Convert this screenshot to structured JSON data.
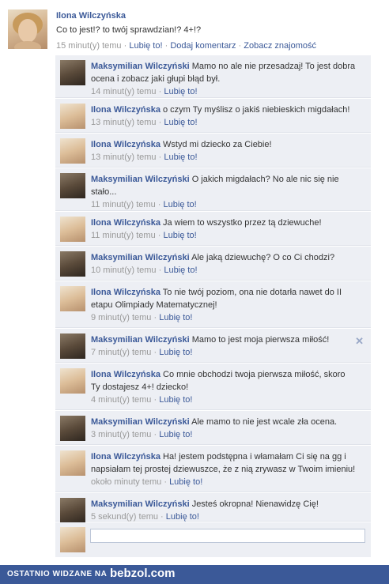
{
  "post": {
    "author": "Ilona Wilczyńska",
    "text": "Co to jest!? to twój sprawdzian!? 4+!?",
    "time": "15 minut(y) temu",
    "like": "Lubię to!",
    "add_comment": "Dodaj komentarz",
    "see_friendship": "Zobacz znajomość",
    "separator": "·"
  },
  "comments": [
    {
      "author": "Maksymilian Wilczyński",
      "avatar": "son-avatar",
      "text": "Mamo no ale nie przesadzaj! To jest dobra ocena i zobacz jaki głupi błąd był.",
      "time": "14 minut(y) temu",
      "like": "Lubię to!"
    },
    {
      "author": "Ilona Wilczyńska",
      "avatar": "mother-avatar",
      "text": "o czym Ty myślisz o jakiś niebieskich migdałach!",
      "time": "13 minut(y) temu",
      "like": "Lubię to!"
    },
    {
      "author": "Ilona Wilczyńska",
      "avatar": "mother-avatar",
      "text": "Wstyd mi dziecko za Ciebie!",
      "time": "13 minut(y) temu",
      "like": "Lubię to!"
    },
    {
      "author": "Maksymilian Wilczyński",
      "avatar": "son-avatar",
      "text": "O jakich migdałach? No ale nic się nie stało...",
      "time": "11 minut(y) temu",
      "like": "Lubię to!"
    },
    {
      "author": "Ilona Wilczyńska",
      "avatar": "mother-avatar",
      "text": "Ja wiem to wszystko przez tą dziewuche!",
      "time": "11 minut(y) temu",
      "like": "Lubię to!"
    },
    {
      "author": "Maksymilian Wilczyński",
      "avatar": "son-avatar",
      "text": "Ale jaką dziewuchę? O co Ci chodzi?",
      "time": "10 minut(y) temu",
      "like": "Lubię to!"
    },
    {
      "author": "Ilona Wilczyńska",
      "avatar": "mother-avatar",
      "text": "To nie twój poziom, ona nie dotarła nawet do II etapu Olimpiady Matematycznej!",
      "time": "9 minut(y) temu",
      "like": "Lubię to!"
    },
    {
      "author": "Maksymilian Wilczyński",
      "avatar": "son-avatar",
      "text": "Mamo to jest moja pierwsza miłość!",
      "time": "7 minut(y) temu",
      "like": "Lubię to!",
      "close": "✕"
    },
    {
      "author": "Ilona Wilczyńska",
      "avatar": "mother-avatar",
      "text": "Co mnie obchodzi twoja pierwsza miłość, skoro Ty dostajesz 4+! dziecko!",
      "time": "4 minut(y) temu",
      "like": "Lubię to!"
    },
    {
      "author": "Maksymilian Wilczyński",
      "avatar": "son-avatar",
      "text": "Ale mamo to nie jest wcale zła ocena.",
      "time": "3 minut(y) temu",
      "like": "Lubię to!"
    },
    {
      "author": "Ilona Wilczyńska",
      "avatar": "mother-avatar",
      "text": "Ha! jestem podstępna i włamałam Ci się na gg i napsiałam tej prostej dziewuszce, że z nią zrywasz w Twoim imieniu!",
      "time": "około minuty temu",
      "like": "Lubię to!"
    },
    {
      "author": "Maksymilian Wilczyński",
      "avatar": "son-avatar",
      "text": "Jesteś okropna! Nienawidzę Cię!",
      "time": "5 sekund(y) temu",
      "like": "Lubię to!"
    }
  ],
  "reply": {
    "placeholder": "",
    "avatar": "mother-avatar"
  },
  "footer": {
    "text": "OSTATNIO WIDZANE NA",
    "logo": "bebzol.com"
  },
  "colors": {
    "link": "#3b5998",
    "comment_bg": "#edeff4",
    "meta": "#999999",
    "footer_bg": "#3b5998"
  }
}
